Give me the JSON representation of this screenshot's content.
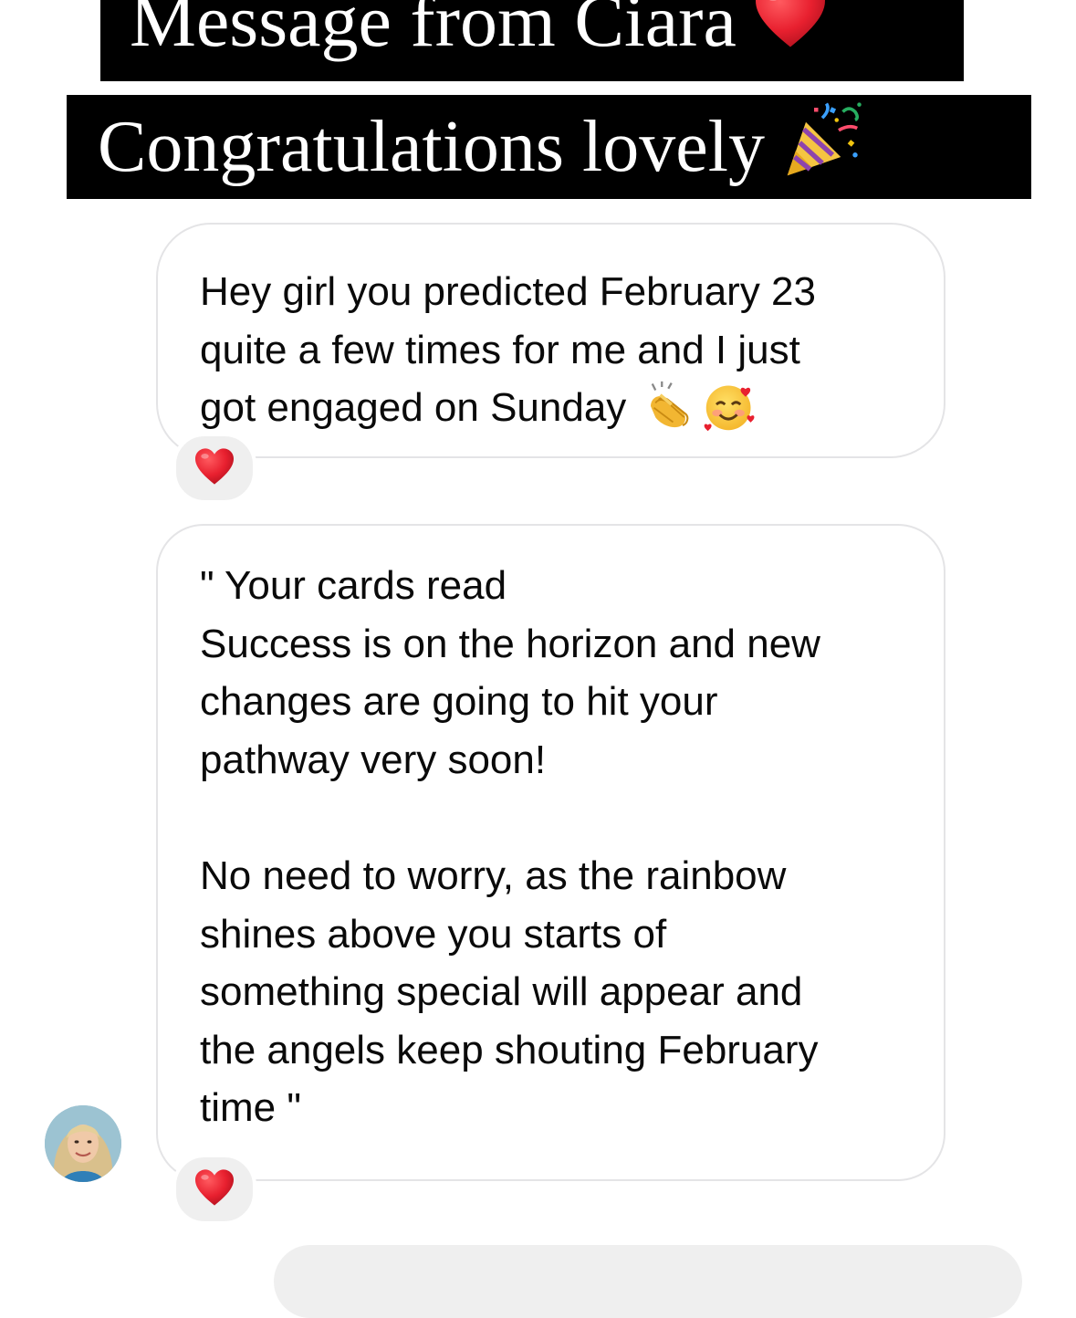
{
  "story_overlay": {
    "title": "Message from Ciara",
    "title_emoji": "red-heart-icon",
    "subtitle": "Congratulations lovely",
    "subtitle_emoji": "party-popper-icon"
  },
  "messages": [
    {
      "lines": [
        "Hey girl you predicted February 23",
        "quite a few times for me and I just",
        "got engaged on Sunday"
      ],
      "trailing_emojis": [
        "clapping-hands-icon",
        "smiling-face-with-hearts-icon"
      ],
      "reaction": "red-heart-icon"
    },
    {
      "paragraph_1": [
        "\" Your cards read",
        "Success is on the horizon and new",
        "changes are going to hit your",
        "pathway very soon!"
      ],
      "paragraph_2": [
        "No need to worry, as the rainbow",
        "shines above you starts of",
        "something special will appear and",
        "the angels keep shouting February",
        "time \""
      ],
      "reaction": "red-heart-icon"
    }
  ],
  "colors": {
    "banner_background": "#000000",
    "banner_text": "#ffffff",
    "bubble_border": "#e4e4e6",
    "reaction_background": "#efefef",
    "heart_red": "#e8202f"
  }
}
